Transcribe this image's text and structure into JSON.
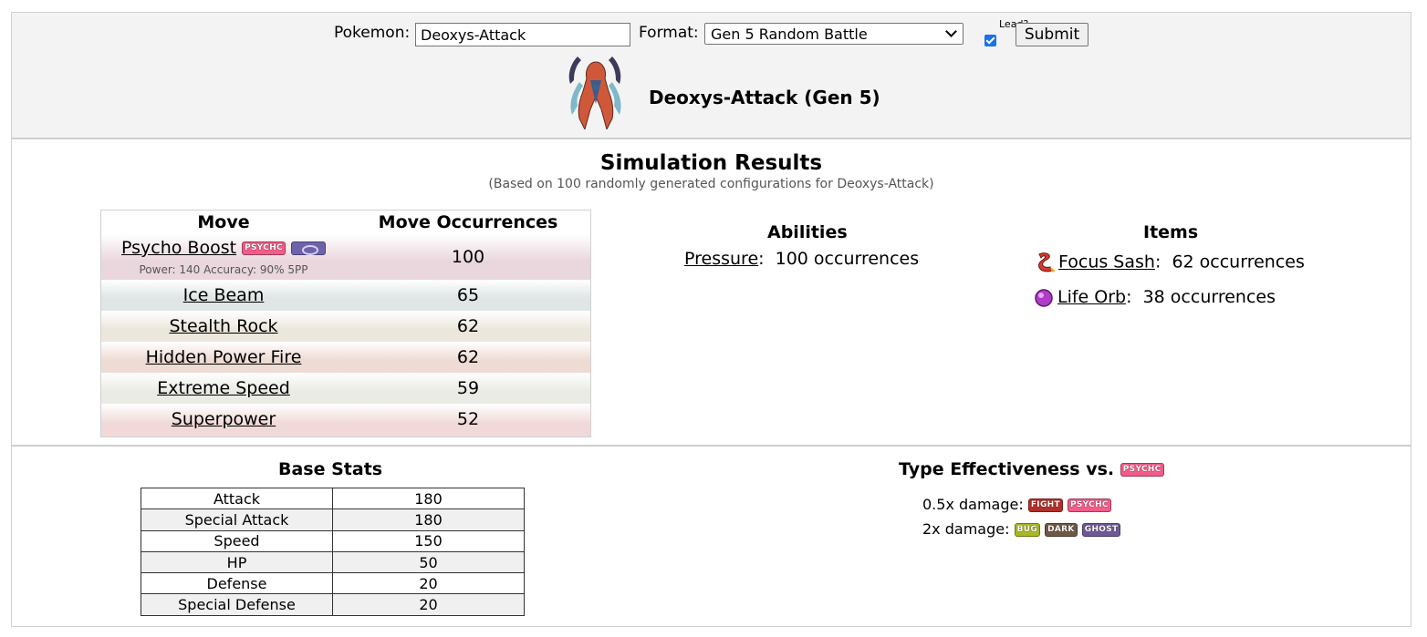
{
  "form": {
    "pokemon_label": "Pokemon:",
    "pokemon_value": "Deoxys-Attack",
    "format_label": "Format:",
    "format_value": "Gen 5 Random Battle",
    "lead_label": "Lead?",
    "lead_checked": true,
    "submit_label": "Submit"
  },
  "pokemon_title": "Deoxys-Attack (Gen 5)",
  "simulation": {
    "title": "Simulation Results",
    "subtitle": "(Based on 100 randomly generated configurations for Deoxys-Attack)"
  },
  "moves_table": {
    "col_move": "Move",
    "col_occurrences": "Move Occurrences",
    "rows": [
      {
        "name": "Psycho Boost",
        "count": "100",
        "type_badge": "PSYCHC",
        "category_icon": "special-icon",
        "detail": "Power: 140   Accuracy: 90%   5PP"
      },
      {
        "name": "Ice Beam",
        "count": "65"
      },
      {
        "name": "Stealth Rock",
        "count": "62"
      },
      {
        "name": "Hidden Power Fire",
        "count": "62"
      },
      {
        "name": "Extreme Speed",
        "count": "59"
      },
      {
        "name": "Superpower",
        "count": "52"
      }
    ],
    "row_colors": [
      "#ead6dd",
      "#dfe6e5",
      "#ece7dc",
      "#eedbd3",
      "#e9ebe4",
      "#f1d9d9"
    ]
  },
  "abilities": {
    "title": "Abilities",
    "items": [
      {
        "name": "Pressure",
        "text": "100 occurrences"
      }
    ]
  },
  "items": {
    "title": "Items",
    "items": [
      {
        "name": "Focus Sash",
        "text": "62 occurrences",
        "icon": "focus-sash-icon"
      },
      {
        "name": "Life Orb",
        "text": "38 occurrences",
        "icon": "life-orb-icon"
      }
    ]
  },
  "base_stats": {
    "title": "Base Stats",
    "rows": [
      {
        "stat": "Attack",
        "value": "180"
      },
      {
        "stat": "Special Attack",
        "value": "180"
      },
      {
        "stat": "Speed",
        "value": "150"
      },
      {
        "stat": "HP",
        "value": "50"
      },
      {
        "stat": "Defense",
        "value": "20"
      },
      {
        "stat": "Special Defense",
        "value": "20"
      }
    ]
  },
  "type_effectiveness": {
    "title": "Type Effectiveness vs.",
    "type_badge": "PSYCHC",
    "half_label": "0.5x damage:",
    "half_types": [
      "FIGHT",
      "PSYCHC"
    ],
    "double_label": "2x damage:",
    "double_types": [
      "BUG",
      "DARK",
      "GHOST"
    ]
  },
  "type_colors": {
    "PSYCHC": "#f35b89",
    "FIGHT": "#b42e28",
    "BUG": "#a8b820",
    "DARK": "#705848",
    "GHOST": "#705898"
  }
}
